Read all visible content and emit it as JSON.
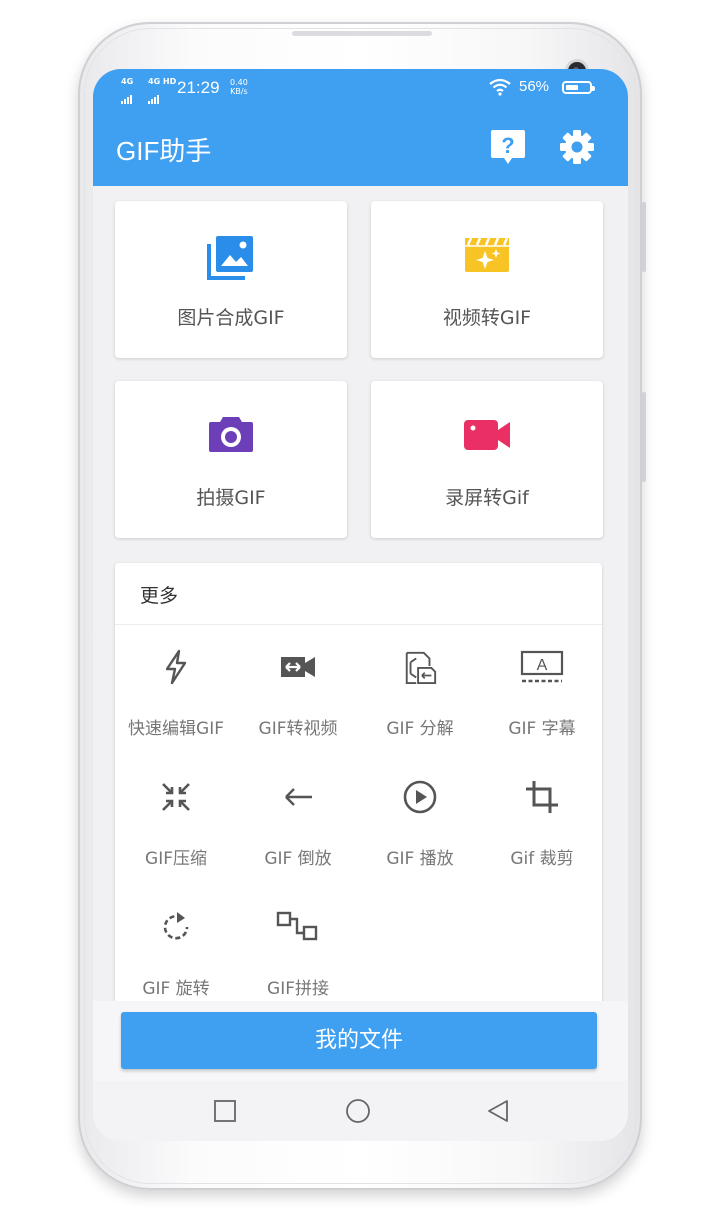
{
  "status_bar": {
    "network1": "4G",
    "network2": "4G HD",
    "time": "21:29",
    "speed_value": "0.40",
    "speed_unit": "KB/s",
    "battery_percent": "56%",
    "battery_level": 0.56,
    "wifi_icon": "wifi-icon",
    "battery_icon": "battery-icon"
  },
  "app_bar": {
    "title": "GIF助手",
    "help_icon": "help-icon",
    "settings_icon": "gear-icon",
    "color": "#3f9ff0"
  },
  "tiles": [
    {
      "label": "图片合成GIF",
      "icon": "images-icon",
      "color": "#2a8de9"
    },
    {
      "label": "视频转GIF",
      "icon": "movie-clapper-icon",
      "color": "#f7c325"
    },
    {
      "label": "拍摄GIF",
      "icon": "camera-icon",
      "color": "#6c3fb8"
    },
    {
      "label": "录屏转Gif",
      "icon": "video-camera-icon",
      "color": "#ea2f64"
    }
  ],
  "more": {
    "title": "更多",
    "tools": [
      {
        "label": "快速编辑GIF",
        "icon": "flash-icon"
      },
      {
        "label": "GIF转视频",
        "icon": "video-convert-icon"
      },
      {
        "label": "GIF 分解",
        "icon": "split-icon"
      },
      {
        "label": "GIF 字幕",
        "icon": "subtitle-icon"
      },
      {
        "label": "GIF压缩",
        "icon": "compress-icon"
      },
      {
        "label": "GIF 倒放",
        "icon": "arrow-left-icon"
      },
      {
        "label": "GIF 播放",
        "icon": "play-icon"
      },
      {
        "label": "Gif 裁剪",
        "icon": "crop-icon"
      },
      {
        "label": "GIF 旋转",
        "icon": "rotate-icon"
      },
      {
        "label": "GIF拼接",
        "icon": "join-icon"
      }
    ]
  },
  "bottom": {
    "files_button": "我的文件"
  },
  "nav": {
    "recents_icon": "square-icon",
    "home_icon": "circle-icon",
    "back_icon": "triangle-back-icon"
  }
}
